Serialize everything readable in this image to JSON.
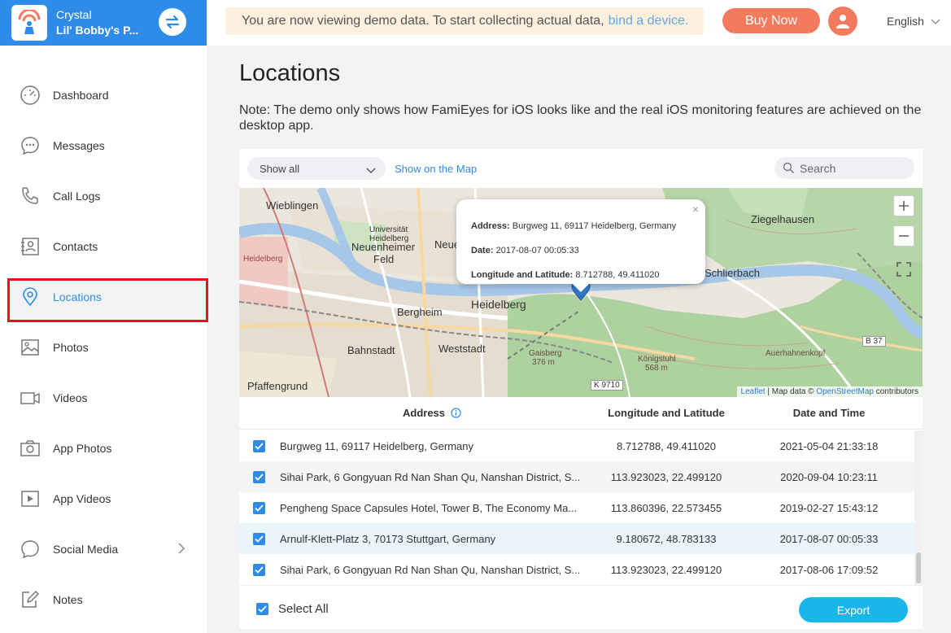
{
  "sidebar": {
    "device_name": "Crystal",
    "device_sub": "Lil' Bobby's P...",
    "items": [
      {
        "label": "Dashboard",
        "icon": "dashboard-icon"
      },
      {
        "label": "Messages",
        "icon": "chat-bubble-icon"
      },
      {
        "label": "Call Logs",
        "icon": "phone-icon"
      },
      {
        "label": "Contacts",
        "icon": "contact-card-icon"
      },
      {
        "label": "Locations",
        "icon": "location-pin-icon",
        "active": true
      },
      {
        "label": "Photos",
        "icon": "image-icon"
      },
      {
        "label": "Videos",
        "icon": "video-camera-icon"
      },
      {
        "label": "App Photos",
        "icon": "camera-icon"
      },
      {
        "label": "App Videos",
        "icon": "play-icon"
      },
      {
        "label": "Social Media",
        "icon": "speech-bubble-icon"
      },
      {
        "label": "Notes",
        "icon": "edit-note-icon"
      }
    ]
  },
  "topbar": {
    "banner_text": "You are now viewing demo data. To start collecting actual data,",
    "banner_link": "bind a device.",
    "buy_label": "Buy Now",
    "language": "English"
  },
  "main": {
    "title": "Locations",
    "note": "Note: The demo only shows how FamiEyes for iOS looks like and the real iOS monitoring features are achieved on the desktop app."
  },
  "toolbar": {
    "filter_value": "Show all",
    "show_map_label": "Show on the Map",
    "search_placeholder": "Search"
  },
  "map": {
    "labels": {
      "wieblingen": "Wieblingen",
      "universitaet": "Universität",
      "heidelberg_small": "Heidelberg",
      "neuenheimer": "Neuenheimer",
      "feld": "Feld",
      "neue": "Neue",
      "heidelberg_west": "Heidelberg",
      "bergheim": "Bergheim",
      "heidelberg": "Heidelberg",
      "bahnstadt": "Bahnstadt",
      "weststadt": "Weststadt",
      "pfaffengrund": "Pfaffengrund",
      "ziegelhausen": "Ziegelhausen",
      "schlierbach": "Schlierbach",
      "gaisberg": "Gaisberg",
      "gaisberg_elev": "376 m",
      "koenigstuhl": "Königstuhl",
      "koenigstuhl_elev": "568 m",
      "auerhahnenkopf": "Auerhahnenkopf",
      "k9710": "K 9710",
      "b37": "B 37"
    },
    "popup": {
      "address_label": "Address:",
      "address_value": "Burgweg 11, 69117 Heidelberg, Germany",
      "date_label": "Date:",
      "date_value": "2017-08-07 00:05:33",
      "ll_label": "Longitude and Latitude:",
      "ll_value": "8.712788, 49.411020",
      "close": "×"
    },
    "attribution": {
      "leaflet": "Leaflet",
      "sep": " | Map data © ",
      "osm": "OpenStreetMap",
      "contributors": " contributors"
    }
  },
  "table": {
    "headers": {
      "address": "Address",
      "longlat": "Longitude and Latitude",
      "datetime": "Date and Time"
    },
    "rows": [
      {
        "address": "Burgweg 11, 69117 Heidelberg, Germany",
        "longlat": "8.712788, 49.411020",
        "datetime": "2021-05-04 21:33:18"
      },
      {
        "address": "Sihai Park, 6 Gongyuan Rd Nan Shan Qu, Nanshan District, S...",
        "longlat": "113.923023, 22.499120",
        "datetime": "2020-09-04 10:23:11"
      },
      {
        "address": "Pengheng Space Capsules Hotel, Tower B, The Economy Ma...",
        "longlat": "113.860396, 22.573455",
        "datetime": "2019-02-27 15:43:12"
      },
      {
        "address": "Arnulf-Klett-Platz 3, 70173 Stuttgart, Germany",
        "longlat": "9.180672, 48.783133",
        "datetime": "2017-08-07 00:05:33"
      },
      {
        "address": "Sihai Park, 6 Gongyuan Rd Nan Shan Qu, Nanshan District, S...",
        "longlat": "113.923023, 22.499120",
        "datetime": "2017-08-06 17:09:52"
      }
    ]
  },
  "footer": {
    "select_all_label": "Select All",
    "export_label": "Export"
  }
}
